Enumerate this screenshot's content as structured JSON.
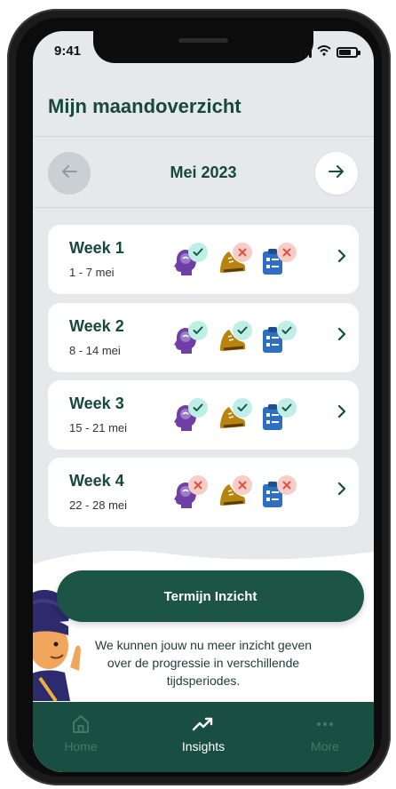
{
  "status": {
    "time": "9:41"
  },
  "header": {
    "title": "Mijn maandoverzicht"
  },
  "month_nav": {
    "label": "Mei 2023",
    "prev_icon": "arrow-left-icon",
    "next_icon": "arrow-right-icon"
  },
  "weeks": [
    {
      "title": "Week 1",
      "dates": "1 - 7 mei",
      "mind": "bad-ok",
      "steps": "bad",
      "tasks": "bad"
    },
    {
      "title": "Week 2",
      "dates": "8 - 14 mei",
      "mind": "ok",
      "steps": "ok",
      "tasks": "ok"
    },
    {
      "title": "Week 3",
      "dates": "15 - 21 mei",
      "mind": "ok",
      "steps": "ok",
      "tasks": "ok"
    },
    {
      "title": "Week 4",
      "dates": "22 - 28 mei",
      "mind": "bad",
      "steps": "bad",
      "tasks": "bad"
    }
  ],
  "cta": {
    "label": "Termijn Inzicht"
  },
  "info": {
    "text": "We kunnen jouw nu meer inzicht geven over de progressie in verschillende tijdsperiodes."
  },
  "tabbar": {
    "items": [
      {
        "label": "Home",
        "icon": "home-icon"
      },
      {
        "label": "Insights",
        "icon": "trend-up-icon"
      },
      {
        "label": "More",
        "icon": "more-dots-icon"
      }
    ]
  },
  "colors": {
    "brand": "#17483a",
    "tabbar": "#184f42",
    "cta": "#1c5446",
    "background": "#e6e9ec",
    "ok_badge": "#bfeee7",
    "bad_badge": "#f7cdc8"
  }
}
